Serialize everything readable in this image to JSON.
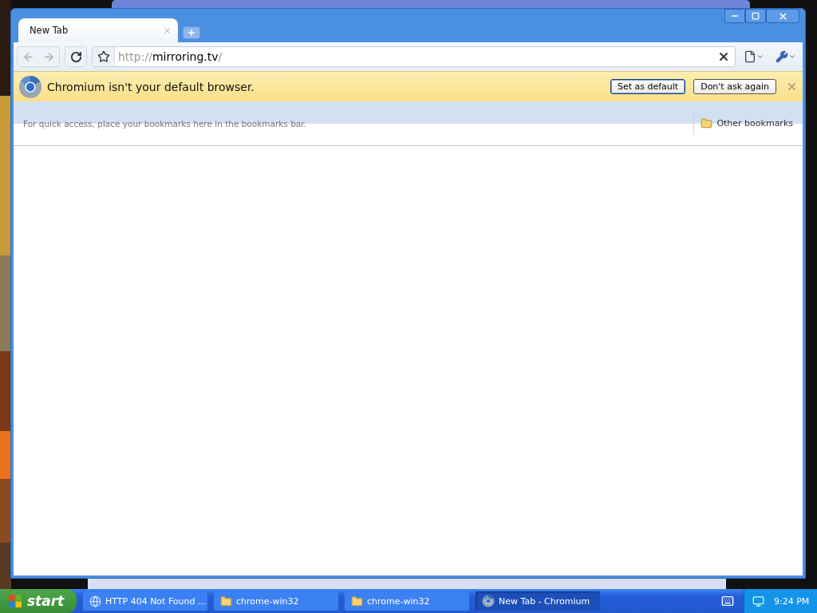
{
  "tabs": [
    {
      "label": "New Tab",
      "selected": true
    }
  ],
  "address": {
    "scheme": "http://",
    "host": "mirroring.tv",
    "path": "/"
  },
  "infobar": {
    "message": "Chromium isn't your default browser.",
    "buttons": [
      {
        "label": "Set as default",
        "selected": true
      },
      {
        "label": "Don't ask again",
        "selected": false
      }
    ]
  },
  "bookmarks_bar": {
    "hint": "For quick access, place your bookmarks here in the bookmarks bar.",
    "other": "Other bookmarks"
  },
  "taskbar": {
    "start": "start",
    "items": [
      {
        "label": "HTTP 404 Not Found ...",
        "kind": "browser",
        "selected": false
      },
      {
        "label": "chrome-win32",
        "kind": "folder",
        "selected": false
      },
      {
        "label": "chrome-win32",
        "kind": "folder",
        "selected": false
      },
      {
        "label": "New Tab - Chromium",
        "kind": "chromium",
        "selected": true
      }
    ],
    "clock": "9:24 PM"
  }
}
